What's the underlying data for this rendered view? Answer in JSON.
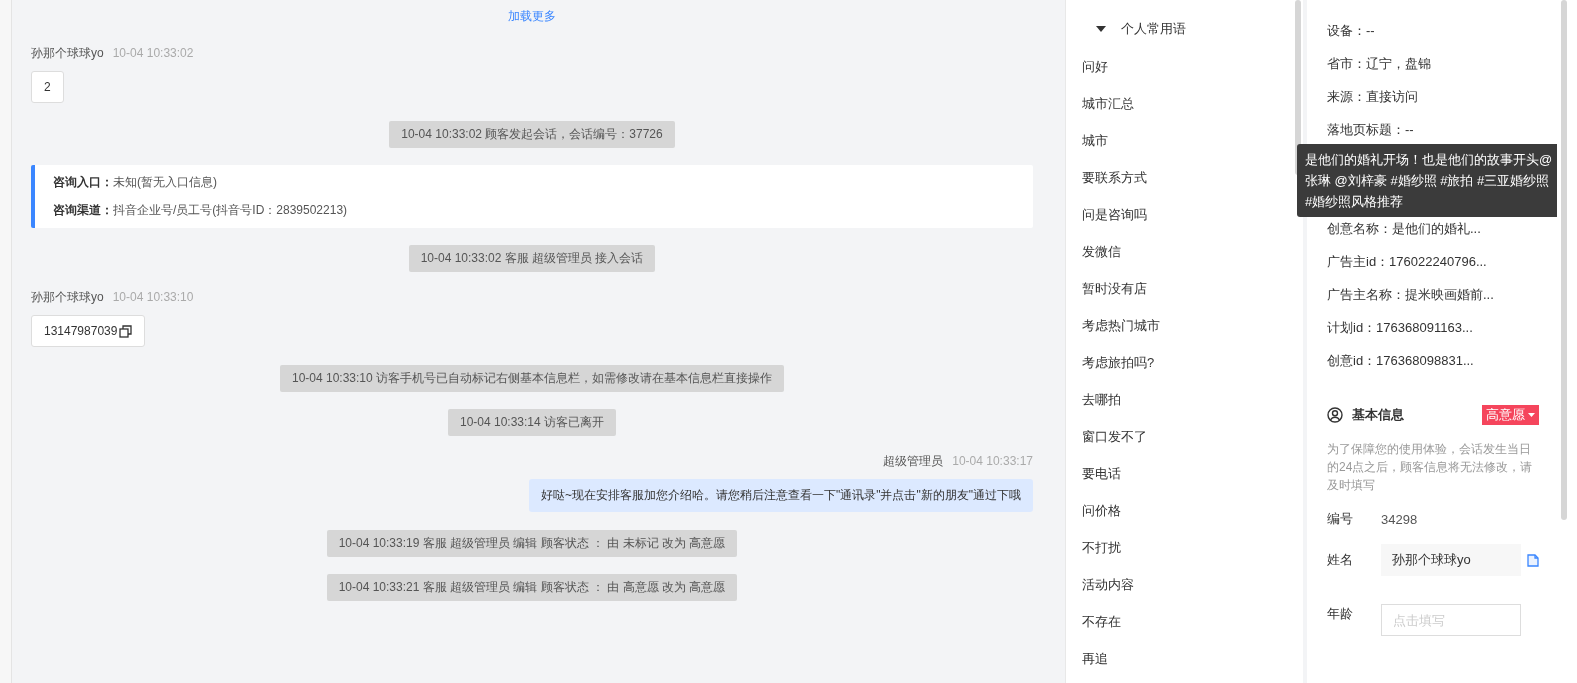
{
  "chat": {
    "load_more": "加载更多",
    "messages": [
      {
        "kind": "visitor",
        "name": "孙那个球球yo",
        "time": "10-04 10:33:02",
        "text": "2",
        "copyable": false
      },
      {
        "kind": "system",
        "text": "10-04 10:33:02 顾客发起会话，会话编号：37726"
      },
      {
        "kind": "card",
        "rows": [
          {
            "label": "咨询入口：",
            "value": "未知(暂无入口信息)"
          },
          {
            "label": "咨询渠道：",
            "value": "抖音企业号/员工号(抖音号ID：2839502213)"
          }
        ]
      },
      {
        "kind": "system",
        "text": "10-04 10:33:02 客服 超级管理员 接入会话"
      },
      {
        "kind": "visitor",
        "name": "孙那个球球yo",
        "time": "10-04 10:33:10",
        "text": "13147987039",
        "copyable": true
      },
      {
        "kind": "system",
        "text": "10-04 10:33:10 访客手机号已自动标记右侧基本信息栏，如需修改请在基本信息栏直接操作"
      },
      {
        "kind": "system",
        "text": "10-04 10:33:14 访客已离开"
      },
      {
        "kind": "agent",
        "name": "超级管理员",
        "time": "10-04 10:33:17",
        "text": "好哒~现在安排客服加您介绍哈。请您稍后注意查看一下\"通讯录\"并点击\"新的朋友\"通过下哦"
      },
      {
        "kind": "system",
        "text": "10-04 10:33:19 客服 超级管理员 编辑 顾客状态 ： 由 未标记 改为 高意愿"
      },
      {
        "kind": "system",
        "text": "10-04 10:33:21 客服 超级管理员 编辑 顾客状态 ： 由 高意愿 改为 高意愿"
      }
    ]
  },
  "phrases": {
    "title": "个人常用语",
    "expanded": true,
    "items": [
      "问好",
      "城市汇总",
      "城市",
      "要联系方式",
      "问是咨询吗",
      "发微信",
      "暂时没有店",
      "考虑热门城市",
      "考虑旅拍吗?",
      "去哪拍",
      "窗口发不了",
      "要电话",
      "问价格",
      "不打扰",
      "活动内容",
      "不存在",
      "再追"
    ]
  },
  "visitor_info": {
    "fields": [
      {
        "kind": "text",
        "text": "设备：--"
      },
      {
        "kind": "text",
        "text": "省市：辽宁，盘锦"
      },
      {
        "kind": "text",
        "text": "来源：直接访问"
      },
      {
        "kind": "text",
        "text": "落地页标题：--"
      },
      {
        "kind": "hidden"
      },
      {
        "kind": "hidden"
      },
      {
        "kind": "text",
        "text": "创意名称：是他们的婚礼..."
      },
      {
        "kind": "text",
        "text": "广告主id：176022240796..."
      },
      {
        "kind": "text",
        "text": "广告主名称：提米映画婚前..."
      },
      {
        "kind": "text",
        "text": "计划id：176368091163..."
      },
      {
        "kind": "text",
        "text": "创意id：176368098831..."
      }
    ],
    "tooltip": "是他们的婚礼开场！也是他们的故事开头@张琳 @刘梓豪 #婚纱照 #旅拍 #三亚婚纱照 #婚纱照风格推荐"
  },
  "basic_info": {
    "title": "基本信息",
    "status": "高意愿",
    "note": "为了保障您的使用体验，会话发生当日的24点之后，顾客信息将无法修改，请及时填写",
    "fields": [
      {
        "kind": "static",
        "label": "编号",
        "value": "34298"
      },
      {
        "kind": "readonly",
        "label": "姓名",
        "value": "孙那个球球yo"
      },
      {
        "kind": "input",
        "label": "年龄",
        "placeholder": "点击填写"
      }
    ]
  }
}
